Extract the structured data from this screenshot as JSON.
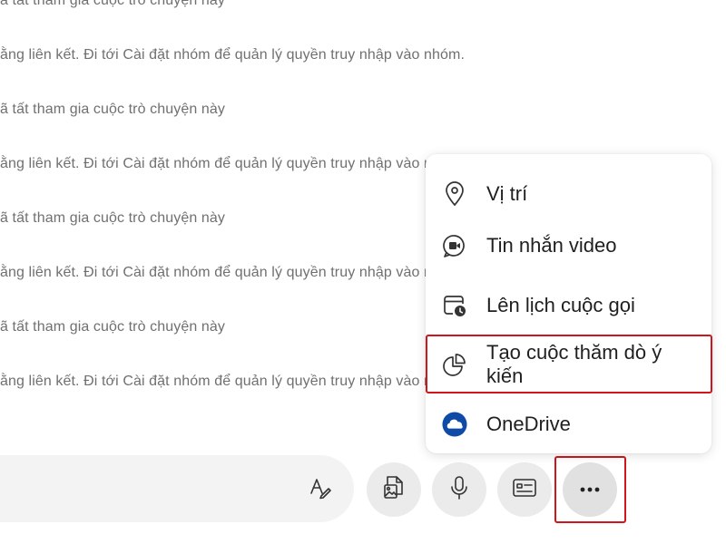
{
  "chat": {
    "messages": [
      {
        "text": "ã tất tham gia cuộc trò chuyện này"
      },
      {
        "text": "ằng liên kết. Đi tới Cài đặt nhóm để quản lý quyền truy nhập vào nhóm."
      },
      {
        "text": "ã tất tham gia cuộc trò chuyện này"
      },
      {
        "text": "ằng liên kết. Đi tới Cài đặt nhóm để quản lý quyền truy nhập vào nhóm."
      },
      {
        "text": "ã tất tham gia cuộc trò chuyện này"
      },
      {
        "text": "ằng liên kết. Đi tới Cài đặt nhóm để quản lý quyền truy nhập vào nhóm."
      },
      {
        "text": "ã tất tham gia cuộc trò chuyện này"
      },
      {
        "text": "ằng liên kết. Đi tới Cài đặt nhóm để quản lý quyền truy nhập vào nhóm."
      }
    ]
  },
  "menu": {
    "items": [
      {
        "label": "Vị trí",
        "icon": "location-pin-icon"
      },
      {
        "label": "Tin nhắn video",
        "icon": "video-message-icon"
      },
      {
        "label": "Lên lịch cuộc gọi",
        "icon": "calendar-clock-icon"
      },
      {
        "label": "Tạo cuộc thăm dò ý kiến",
        "icon": "poll-icon"
      },
      {
        "label": "OneDrive",
        "icon": "onedrive-icon"
      }
    ]
  },
  "toolbar": {
    "buttons": [
      "format-text-icon",
      "media-gallery-icon",
      "microphone-icon",
      "contact-card-icon",
      "more-icon"
    ]
  },
  "colors": {
    "highlight": "#d0161b",
    "onedrive": "#0f4aa6",
    "text": "#1f1f1f",
    "system_text": "#707070"
  }
}
